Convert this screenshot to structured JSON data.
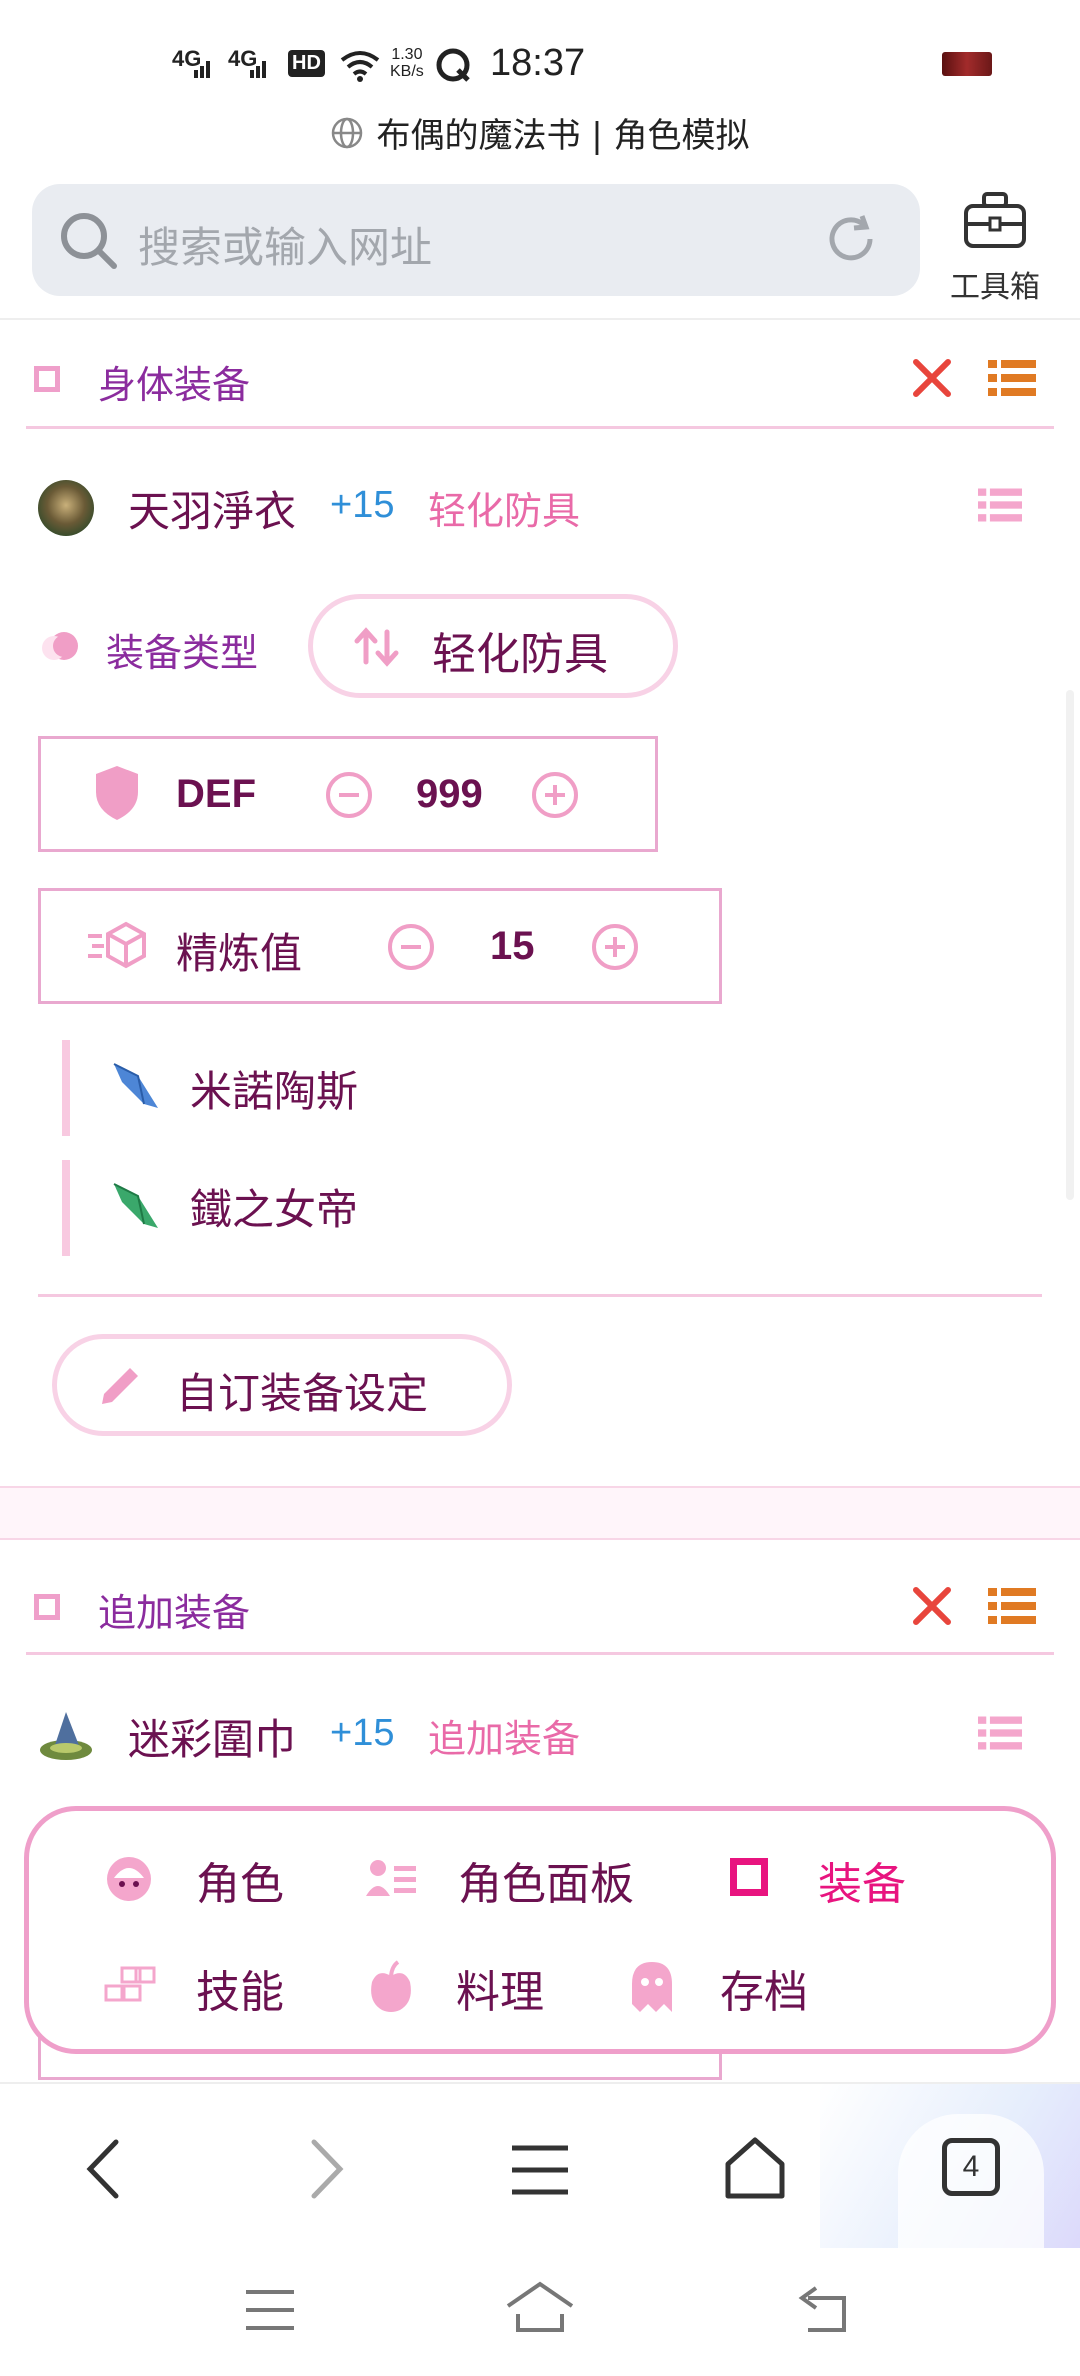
{
  "status_bar": {
    "signal1": "4G",
    "signal2": "4G",
    "hd": "HD",
    "speed_value": "1.30",
    "speed_unit": "KB/s",
    "time": "18:37"
  },
  "browser": {
    "page_title": "布偶的魔法书 | 角色模拟",
    "search_placeholder": "搜索或输入网址",
    "toolbox_label": "工具箱",
    "tab_count": "4"
  },
  "body_equipment": {
    "section_title": "身体装备",
    "item_name": "天羽淨衣",
    "refine_plus": "+15",
    "item_type_tag": "轻化防具",
    "type_label": "装备类型",
    "type_value": "轻化防具",
    "def": {
      "label": "DEF",
      "value": "999"
    },
    "refine": {
      "label": "精炼值",
      "value": "15"
    },
    "gems": [
      {
        "name": "米諾陶斯"
      },
      {
        "name": "鐵之女帝"
      }
    ],
    "custom_button": "自订装备设定"
  },
  "additional_equipment": {
    "section_title": "追加装备",
    "item_name": "迷彩圍巾",
    "refine_plus": "+15",
    "item_type_tag": "追加装备"
  },
  "bottom_nav": {
    "items": [
      {
        "label": "角色",
        "icon": "face-icon"
      },
      {
        "label": "角色面板",
        "icon": "id-card-icon"
      },
      {
        "label": "装备",
        "icon": "square-icon"
      },
      {
        "label": "技能",
        "icon": "blocks-icon"
      },
      {
        "label": "料理",
        "icon": "apple-icon"
      },
      {
        "label": "存档",
        "icon": "ghost-icon"
      }
    ]
  },
  "colors": {
    "accent_pink": "#e96aa8",
    "dark_magenta": "#6b1150",
    "purple_title": "#8b2c9e",
    "blue_plus": "#2f8fd8",
    "close_red": "#e8453c",
    "menu_orange": "#e07a23"
  }
}
